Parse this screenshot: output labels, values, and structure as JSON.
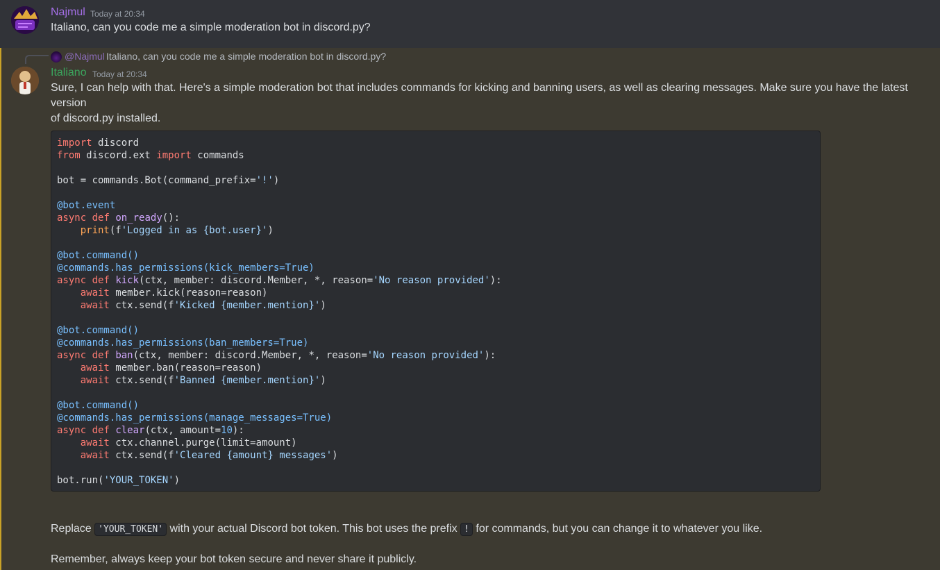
{
  "message1": {
    "author": "Najmul",
    "author_color": "#a46fe6",
    "timestamp": "Today at 20:34",
    "text": "Italiano, can you code me a simple moderation bot in discord.py?"
  },
  "message2": {
    "reply": {
      "mention": "@Najmul",
      "text": "Italiano, can you code me a simple moderation bot in discord.py?"
    },
    "author": "Italiano",
    "author_color": "#3ba55d",
    "timestamp": "Today at 20:34",
    "intro_line1": "Sure, I can help with that. Here's a simple moderation bot that includes commands for kicking and banning users, as well as clearing messages. Make sure you have the latest version",
    "intro_line2": "of discord.py installed.",
    "code_lines": [
      "import discord",
      "from discord.ext import commands",
      "",
      "bot = commands.Bot(command_prefix='!')",
      "",
      "@bot.event",
      "async def on_ready():",
      "    print(f'Logged in as {bot.user}')",
      "",
      "@bot.command()",
      "@commands.has_permissions(kick_members=True)",
      "async def kick(ctx, member: discord.Member, *, reason='No reason provided'):",
      "    await member.kick(reason=reason)",
      "    await ctx.send(f'Kicked {member.mention}')",
      "",
      "@bot.command()",
      "@commands.has_permissions(ban_members=True)",
      "async def ban(ctx, member: discord.Member, *, reason='No reason provided'):",
      "    await member.ban(reason=reason)",
      "    await ctx.send(f'Banned {member.mention}')",
      "",
      "@bot.command()",
      "@commands.has_permissions(manage_messages=True)",
      "async def clear(ctx, amount=10):",
      "    await ctx.channel.purge(limit=amount)",
      "    await ctx.send(f'Cleared {amount} messages')",
      "",
      "bot.run('YOUR_TOKEN')"
    ],
    "para1_before": "Replace ",
    "para1_code1": "'YOUR_TOKEN'",
    "para1_mid": " with your actual Discord bot token. This bot uses the prefix ",
    "para1_code2": "!",
    "para1_after": " for commands, but you can change it to whatever you like.",
    "para2": "Remember, always keep your bot token secure and never share it publicly."
  }
}
